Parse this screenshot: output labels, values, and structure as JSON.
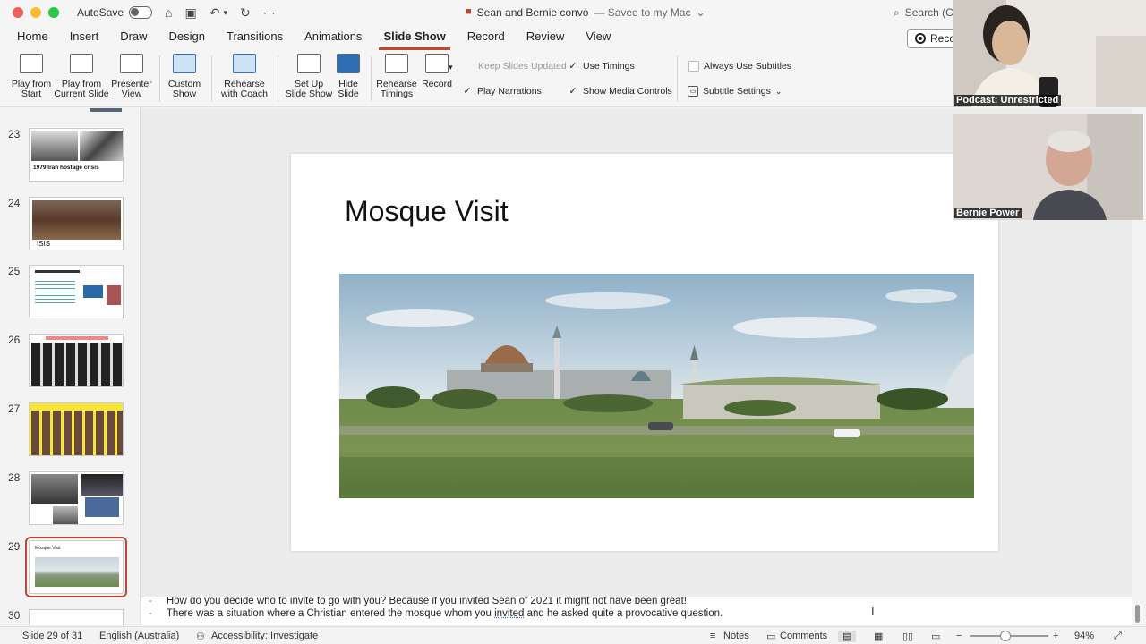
{
  "titlebar": {
    "autosave_label": "AutoSave",
    "document_title": "Sean and Bernie convo",
    "saved_status": "— Saved to my Mac",
    "search_placeholder": "Search (C"
  },
  "ribbon_tabs": [
    "Home",
    "Insert",
    "Draw",
    "Design",
    "Transitions",
    "Animations",
    "Slide Show",
    "Record",
    "Review",
    "View"
  ],
  "active_tab": "Slide Show",
  "record_button_label": "Reco",
  "ribbon": {
    "play_from_start": "Play from\nStart",
    "play_from_current": "Play from\nCurrent Slide",
    "presenter_view": "Presenter\nView",
    "custom_show": "Custom\nShow",
    "rehearse_with_coach": "Rehearse\nwith Coach",
    "set_up_slide_show": "Set Up\nSlide Show",
    "hide_slide": "Hide\nSlide",
    "rehearse_timings": "Rehearse\nTimings",
    "record": "Record",
    "keep_slides_updated": "Keep Slides Updated",
    "use_timings": "Use Timings",
    "play_narrations": "Play Narrations",
    "show_media_controls": "Show Media Controls",
    "always_use_subtitles": "Always Use Subtitles",
    "subtitle_settings": "Subtitle Settings"
  },
  "thumbnails": [
    {
      "number": "23",
      "caption": "1979 Iran hostage crisis"
    },
    {
      "number": "24",
      "caption": "ISIS"
    },
    {
      "number": "25",
      "caption": ""
    },
    {
      "number": "26",
      "caption": ""
    },
    {
      "number": "27",
      "caption": ""
    },
    {
      "number": "28",
      "caption": ""
    },
    {
      "number": "29",
      "caption": "Mosque Visit"
    },
    {
      "number": "30",
      "caption": ""
    }
  ],
  "slide": {
    "title": "Mosque Visit"
  },
  "notes": {
    "line1": "How do you decide who to invite to go with you? Because if you invited Sean of 2021 it might not have been great!",
    "line2_before": "There was a situation where a Christian entered the mosque whom you ",
    "line2_underlined": "invited",
    "line2_after": " and he asked quite a provocative question."
  },
  "status": {
    "slide_counter": "Slide 29 of 31",
    "language": "English (Australia)",
    "accessibility": "Accessibility: Investigate",
    "notes_label": "Notes",
    "comments_label": "Comments",
    "zoom": "94%"
  },
  "webcams": {
    "top_label": "Podcast: Unrestricted",
    "bottom_label": "Bernie Power"
  }
}
